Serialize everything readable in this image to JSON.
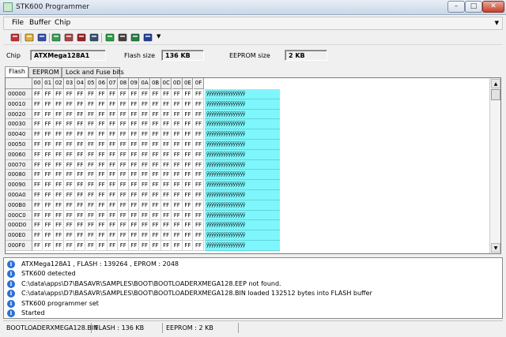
{
  "window": {
    "title": "STK600 Programmer",
    "min": "–",
    "max": "□",
    "close": "✕"
  },
  "menu": [
    "File",
    "Buffer",
    "Chip"
  ],
  "toolbar": [
    {
      "name": "erase-icon",
      "color": "#c83030"
    },
    {
      "name": "open-file-icon",
      "color": "#e0b030"
    },
    {
      "name": "save-icon",
      "color": "#3050b0"
    },
    {
      "name": "program-icon",
      "color": "#30a050"
    },
    {
      "name": "verify-icon",
      "color": "#b04040"
    },
    {
      "name": "chip-read-icon",
      "color": "#a02020"
    },
    {
      "name": "chip-write-icon",
      "color": "#305070"
    },
    {
      "name": "lock-icon",
      "color": "#20a040"
    },
    {
      "name": "chip-icon",
      "color": "#404040"
    },
    {
      "name": "fuse-icon",
      "color": "#208040"
    },
    {
      "name": "config-icon",
      "color": "#2040a0"
    }
  ],
  "info": {
    "chip_label": "Chip",
    "chip_value": "ATXMega128A1",
    "flash_label": "Flash size",
    "flash_value": "136 KB",
    "eeprom_label": "EEPROM size",
    "eeprom_value": "2 KB"
  },
  "tabs": [
    "Flash",
    "EEPROM",
    "Lock and Fuse bits"
  ],
  "grid": {
    "columns": [
      "00",
      "01",
      "02",
      "03",
      "04",
      "05",
      "06",
      "07",
      "08",
      "09",
      "0A",
      "0B",
      "0C",
      "0D",
      "0E",
      "0F"
    ],
    "byte_value": "FF",
    "ascii_value": "ÿÿÿÿÿÿÿÿÿÿÿÿÿÿÿÿ",
    "rows": [
      "00000",
      "00010",
      "00020",
      "00030",
      "00040",
      "00050",
      "00060",
      "00070",
      "00080",
      "00090",
      "000A0",
      "000B0",
      "000C0",
      "000D0",
      "000E0",
      "000F0"
    ],
    "ascii_color": "#7ff6fb"
  },
  "log": [
    "ATXMega128A1 , FLASH : 139264 , EPROM : 2048",
    "STK600 detected",
    "C:\\data\\apps\\D7\\BASAVR\\SAMPLES\\BOOT\\BOOTLOADERXMEGA128.EEP not found.",
    "C:\\data\\apps\\D7\\BASAVR\\SAMPLES\\BOOT\\BOOTLOADERXMEGA128.BIN loaded 132512 bytes into FLASH buffer",
    "STK600 programmer set",
    "Started"
  ],
  "status": {
    "file": "BOOTLOADERXMEGA128.BIN",
    "flash": "FLASH : 136 KB",
    "eeprom": "EEPROM : 2 KB"
  }
}
